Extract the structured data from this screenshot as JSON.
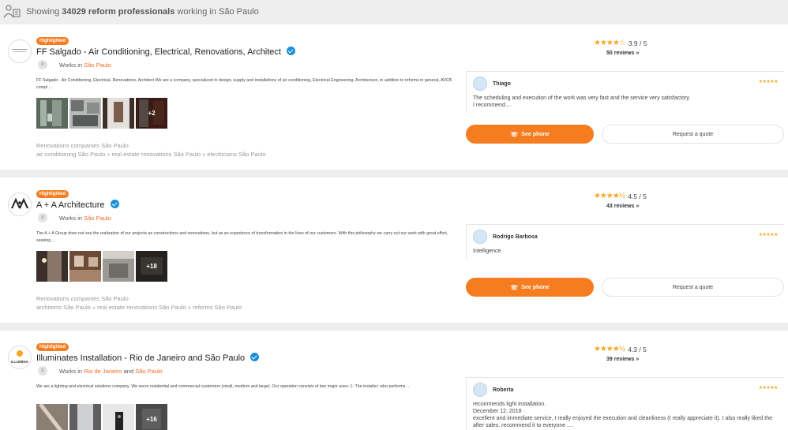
{
  "header": {
    "prefix": "Showing",
    "count": "34029 reform professionals",
    "suffix": "working in São Paulo"
  },
  "listings": [
    {
      "badge": "Highlighted",
      "title": "FF Salgado - Air Conditioning, Electrical, Renovations, Architect",
      "works_prefix": "Works in",
      "locations": [
        "São Paulo"
      ],
      "description": "FF Salgado - Air Conditioning, Electrical, Renovations, Architect We are a company, specialized in design, supply and installations of air conditioning, Electrical Engineering, Architecture, in addition to reforms in general, AVCB compl ...",
      "more_photos": "+2",
      "category": "Renovations companies São Paulo",
      "tags": "air conditioning São Paulo » real estate renovations São Paulo » electricians São Paulo",
      "rating": "3.9 / 5",
      "rating_value": 3.9,
      "reviews": "50 reviews »",
      "review_name": "Thiago",
      "review_text": "The scheduling and execution of the work was very fast and the service very satisfactory.",
      "review_more": "I recommend....",
      "phone_btn": "See phone",
      "quote_btn": "Request a quote"
    },
    {
      "badge": "Highlighted",
      "title": "A + A Architecture",
      "works_prefix": "Works in",
      "locations": [
        "São Paulo"
      ],
      "description": "The A + A Group does not see the realization of our projects as constructions and renovations, but as an experience of transformation in the lives of our customers. With this philosophy we carry out our work with great effort, seeking ...",
      "more_photos": "+18",
      "category": "Renovations companies São Paulo",
      "tags": "architects São Paulo » real estate renovations São Paulo » reforms São Paulo",
      "rating": "4.5 / 5",
      "rating_value": 4.5,
      "reviews": "43 reviews »",
      "review_name": "Rodrigo Barbosa",
      "review_text": "Intelligence.",
      "review_more": "",
      "phone_btn": "See phone",
      "quote_btn": "Request a quote"
    },
    {
      "badge": "Highlighted",
      "title": "Illuminates Installation - Rio de Janeiro and São Paulo",
      "works_prefix": "Works in",
      "locations": [
        "Rio de Janeiro",
        "São Paulo"
      ],
      "joiner": "and",
      "logo_text": "ILLUMINA",
      "description": "We are a lighting and electrical solutions company. We serve residential and commercial customers (small, medium and large). Our operation consists of two major axes: 1- The installer: who performs ...",
      "more_photos": "+16",
      "rating": "4.3 / 5",
      "rating_value": 4.3,
      "reviews": "39 reviews »",
      "review_name": "Roberta",
      "review_text": "recommends light installation.",
      "review_date": "December 12, 2018 ·",
      "review_more": "excellent and immediate service, I really enjoyed the execution and cleanliness (I really appreciate it). I also really liked the after sales. recommend it to everyone ...."
    }
  ],
  "colors": {
    "accent": "#f57c1f",
    "link": "#f26a21",
    "verified": "#1a8fd8",
    "star": "#f5a623"
  }
}
